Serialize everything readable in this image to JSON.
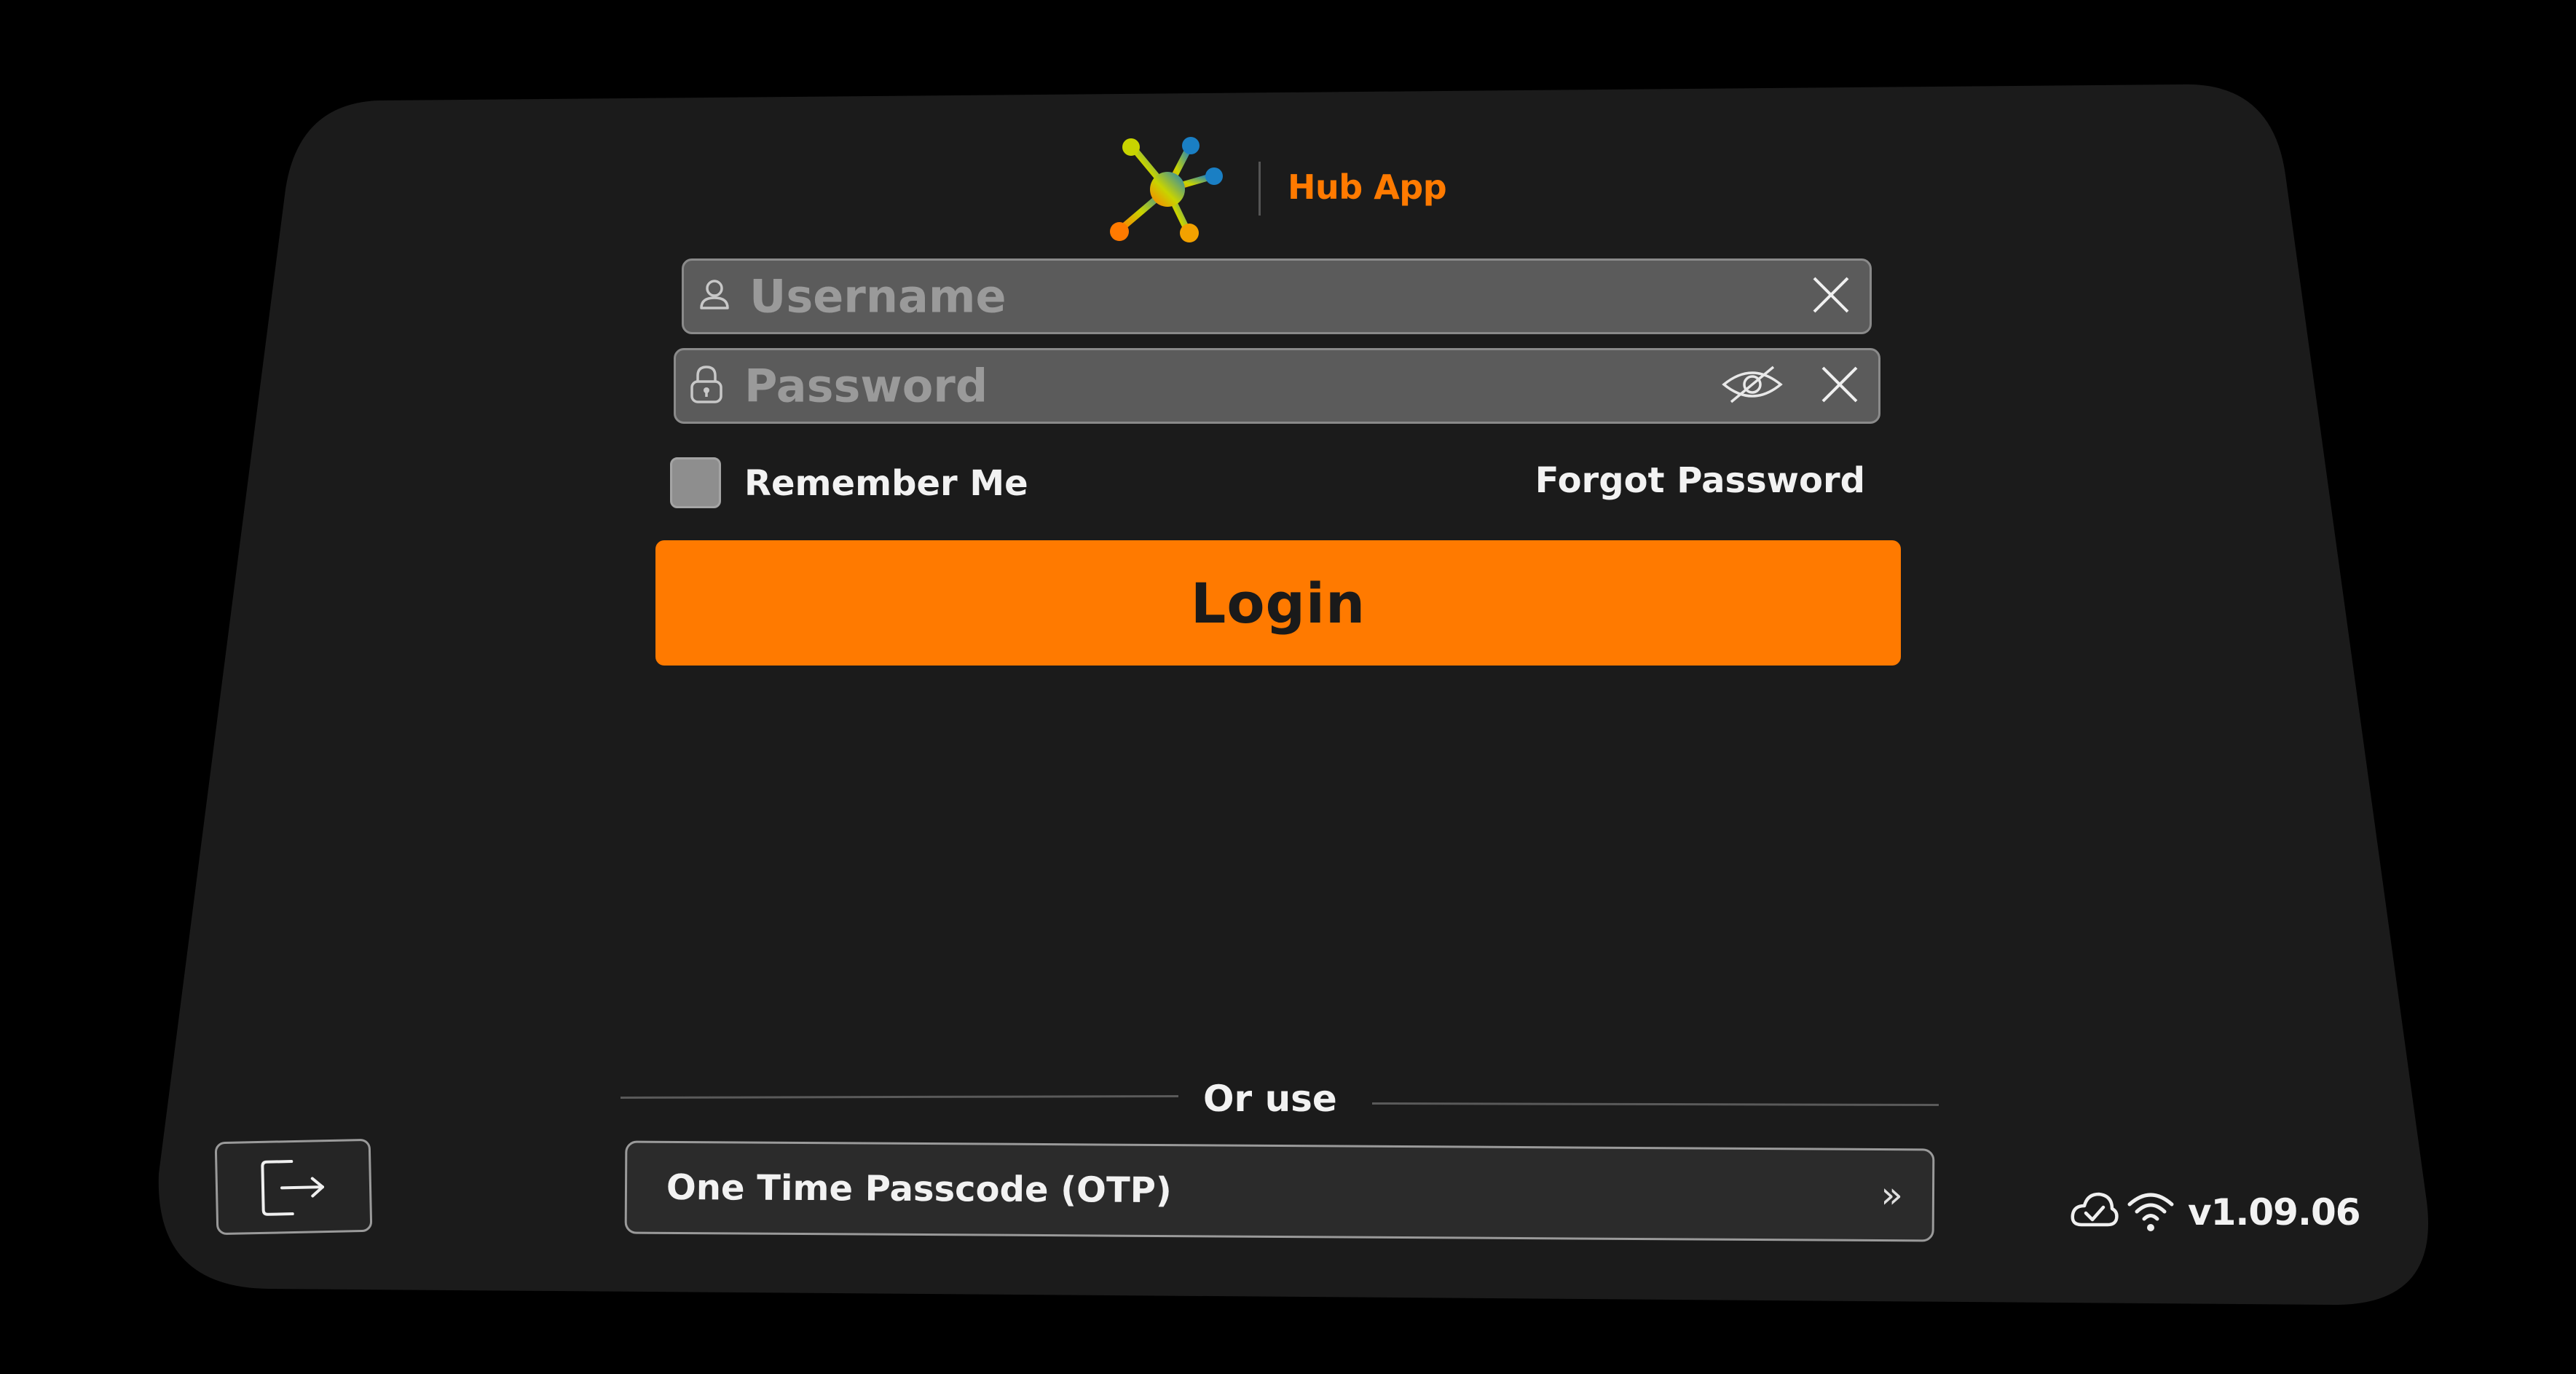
{
  "header": {
    "app_name": "Hub App",
    "logo_icon": "molecule-logo-icon"
  },
  "login_form": {
    "username": {
      "placeholder": "Username",
      "icon": "user-icon",
      "clear_icon": "close-icon"
    },
    "password": {
      "placeholder": "Password",
      "icon": "lock-icon",
      "visibility_icon": "eye-off-icon",
      "clear_icon": "close-icon"
    },
    "remember_me": {
      "label": "Remember Me",
      "checked": false
    },
    "forgot_password_label": "Forgot Password",
    "login_label": "Login"
  },
  "alternatives": {
    "divider_label": "Or use",
    "otp_label": "One Time Passcode (OTP)",
    "otp_chevron": "»"
  },
  "footer": {
    "exit_icon": "exit-icon",
    "cloud_icon": "cloud-check-icon",
    "wifi_icon": "wifi-icon",
    "version": "v1.09.06"
  },
  "colors": {
    "accent": "#ff7a00",
    "panel": "#1b1b1b",
    "background": "#000000",
    "field": "#5b5b5b"
  }
}
